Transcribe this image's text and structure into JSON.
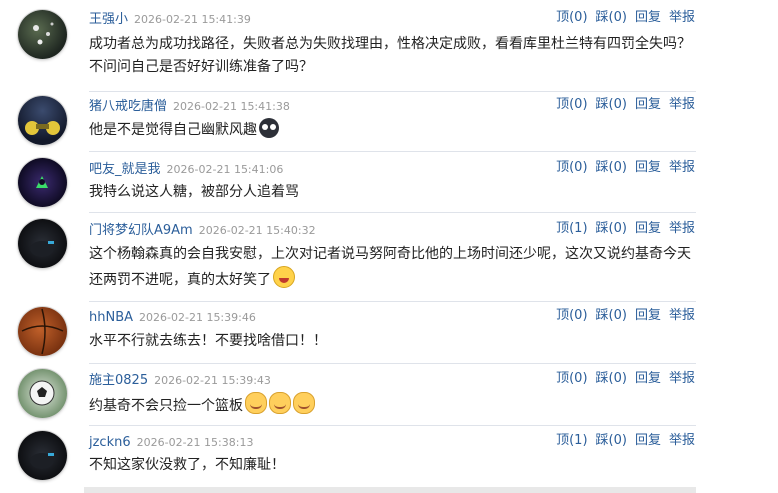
{
  "action_labels": {
    "up": "顶",
    "down": "踩",
    "reply": "回复",
    "report": "举报"
  },
  "comments": [
    {
      "user": "王强小",
      "time": "2026-02-21 15:41:39",
      "up": "(0)",
      "down": "(0)",
      "lines": [
        "成功者总为成功找路径，失败者总为失败找理由，性格决定成败，看看库里杜兰特有四罚全失吗？",
        "不问问自己是否好好训练准备了吗？"
      ]
    },
    {
      "user": "猪八戒吃唐僧",
      "time": "2026-02-21 15:41:38",
      "up": "(0)",
      "down": "(0)",
      "lines": [
        "他是不是觉得自己幽默风趣"
      ],
      "emoji": "dark-face-icon"
    },
    {
      "user": "吧友_就是我",
      "time": "2026-02-21 15:41:06",
      "up": "(0)",
      "down": "(0)",
      "lines": [
        "我特么说这人糖，被部分人追着骂"
      ]
    },
    {
      "user": "门将梦幻队A9Am",
      "time": "2026-02-21 15:40:32",
      "up": "(1)",
      "down": "(0)",
      "lines": [
        "这个杨翰森真的会自我安慰，上次对记者说马努阿奇比他的上场时间还少呢，这次又说约基奇今天",
        "还两罚不进呢，真的太好笑了"
      ],
      "emoji": "laughing-tears-icon"
    },
    {
      "user": "hhNBA",
      "time": "2026-02-21 15:39:46",
      "up": "(0)",
      "down": "(0)",
      "lines": [
        "水平不行就去练去！不要找啥借口！！"
      ]
    },
    {
      "user": "施主0825",
      "time": "2026-02-21 15:39:43",
      "up": "(0)",
      "down": "(0)",
      "lines": [
        "约基奇不会只捡一个篮板"
      ],
      "emoji_triple": "laughing-cat-icon"
    },
    {
      "user": "jzckn6",
      "time": "2026-02-21 15:38:13",
      "up": "(1)",
      "down": "(0)",
      "lines": [
        "不知这家伙没救了，不知廉耻！"
      ]
    }
  ]
}
